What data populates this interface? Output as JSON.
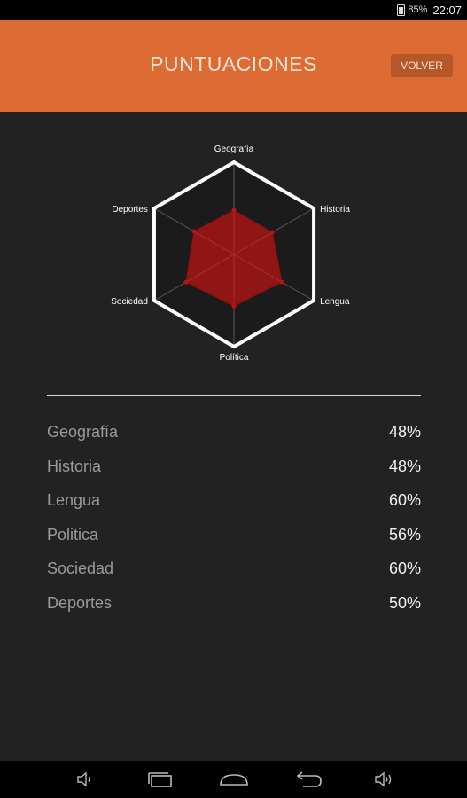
{
  "status_bar": {
    "battery": "85%",
    "time": "22:07",
    "icon": "battery-icon"
  },
  "app_bar": {
    "title": "PUNTUACIONES",
    "back_label": "VOLVER",
    "color": "#dd6b34"
  },
  "chart_data": {
    "type": "radar",
    "axes": [
      "Geografía",
      "Historia",
      "Lengua",
      "Política",
      "Sociedad",
      "Deportes"
    ],
    "values": [
      48,
      48,
      60,
      56,
      60,
      50
    ],
    "max": 100,
    "fill_color": "#a11414",
    "outline_color": "#ffffff"
  },
  "scores": [
    {
      "label": "Geografía",
      "value": "48%"
    },
    {
      "label": "Historia",
      "value": "48%"
    },
    {
      "label": "Lengua",
      "value": "60%"
    },
    {
      "label": "Politica",
      "value": "56%"
    },
    {
      "label": "Sociedad",
      "value": "60%"
    },
    {
      "label": "Deportes",
      "value": "50%"
    }
  ],
  "nav_bar": {
    "icons": [
      "volume-down-icon",
      "recent-apps-icon",
      "home-icon",
      "back-icon",
      "volume-up-icon"
    ]
  }
}
